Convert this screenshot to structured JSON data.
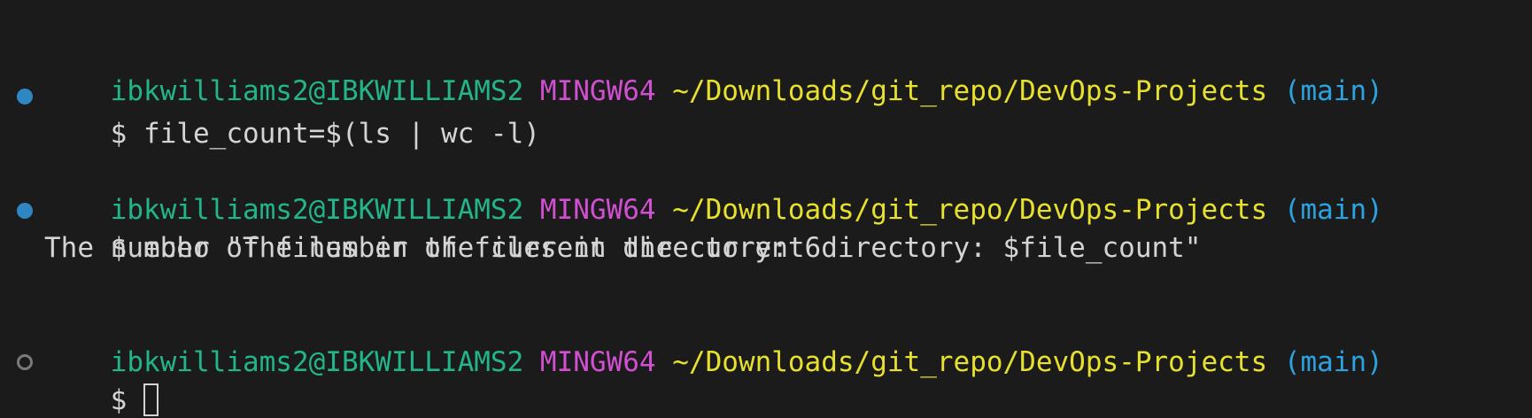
{
  "prompt": {
    "user_host": "ibkwilliams2@IBKWILLIAMS2",
    "system": "MINGW64",
    "path": "~/Downloads/git_repo/DevOps-Projects",
    "branch_open": "(",
    "branch": "main",
    "branch_close": ")",
    "symbol": "$"
  },
  "commands": [
    {
      "text": "file_count=$(ls | wc -l)",
      "status": "completed"
    },
    {
      "text": "echo \"The number of files in the current directory: $file_count\"",
      "status": "completed"
    }
  ],
  "outputs": [
    "The number of files in the current directory: 6"
  ],
  "colors": {
    "background": "#1b1b1b",
    "user_host": "#23b58a",
    "system": "#d14fd1",
    "path": "#e7e02c",
    "branch": "#2ba3e0",
    "text": "#d4d4d4",
    "decoration_done": "#2f86c3",
    "decoration_pending": "#7a7a7a"
  }
}
